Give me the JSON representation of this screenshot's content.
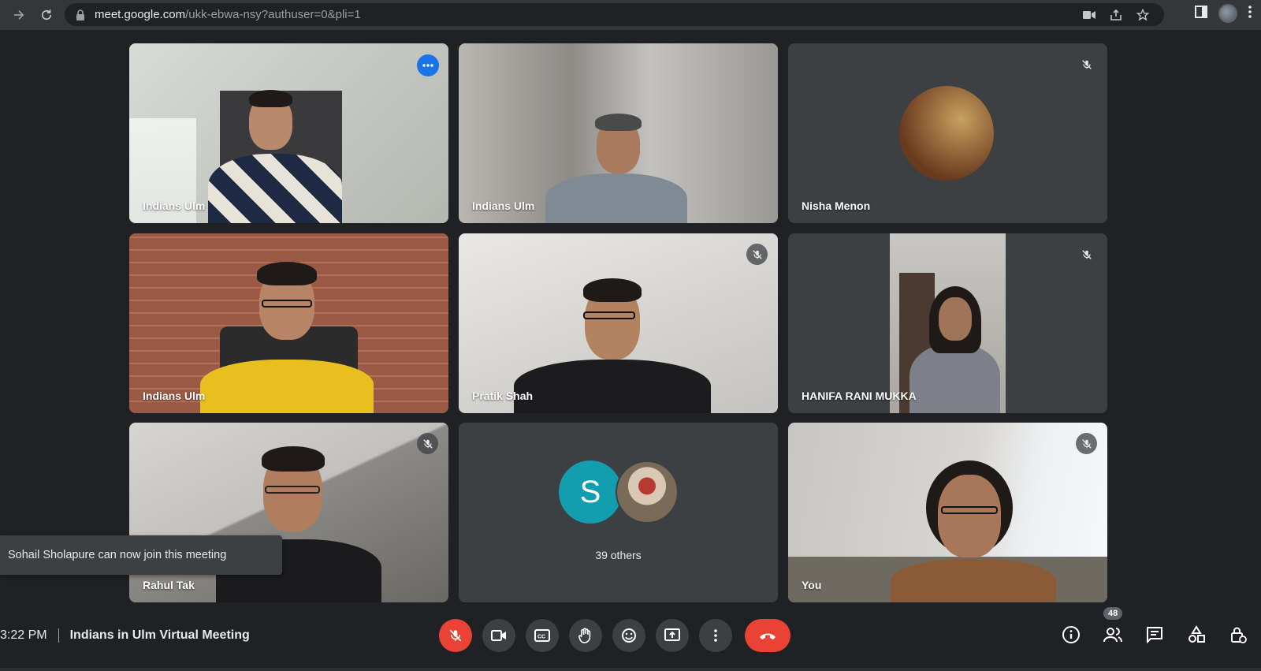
{
  "browser": {
    "url_host": "meet.google.com",
    "url_path": "/ukk-ebwa-nsy?authuser=0&pli=1",
    "icons": [
      "back-arrow-icon",
      "reload-icon",
      "lock-icon",
      "camera-icon",
      "share-icon",
      "star-icon",
      "sidepanel-icon",
      "profile-avatar",
      "menu-dots-icon"
    ]
  },
  "tiles": [
    {
      "name": "Indians Ulm",
      "muted": false,
      "active": true
    },
    {
      "name": "Indians Ulm",
      "muted": false
    },
    {
      "name": "Nisha Menon",
      "muted": true
    },
    {
      "name": "Indians Ulm",
      "muted": false
    },
    {
      "name": "Pratik Shah",
      "muted": true
    },
    {
      "name": "HANIFA RANI MUKKA",
      "muted": true
    },
    {
      "name": "Rahul Tak",
      "muted": true
    },
    {
      "name": "",
      "muted": false,
      "avatar_letter": "S",
      "others_label": "39 others"
    },
    {
      "name": "You",
      "muted": true
    }
  ],
  "toast": {
    "text": "Sohail Sholapure can now join this meeting"
  },
  "footer": {
    "time": "3:22 PM",
    "meeting_title": "Indians in Ulm Virtual Meeting",
    "participants_count": "48"
  },
  "controls": [
    "mic-off-button",
    "camera-button",
    "captions-button",
    "raise-hand-button",
    "emoji-button",
    "present-button",
    "more-options-button",
    "leave-call-button"
  ],
  "colors": {
    "accent": "#8ab4f8",
    "danger": "#ea4335",
    "avatar_s": "#129eaf",
    "background": "#202124"
  }
}
